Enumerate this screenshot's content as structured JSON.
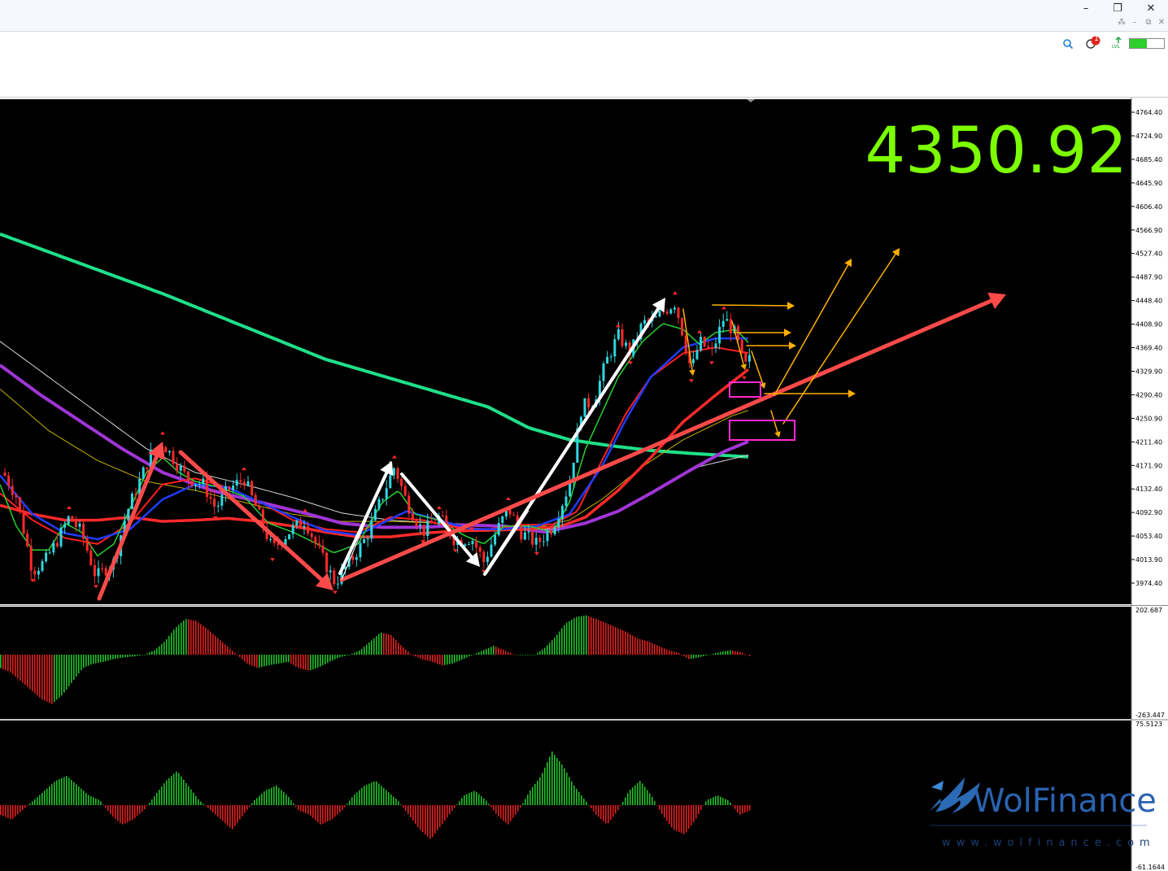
{
  "window": {
    "buttons": [
      {
        "name": "minimize",
        "glyph": "–"
      },
      {
        "name": "restore",
        "glyph": "❐"
      },
      {
        "name": "close",
        "glyph": "✕"
      }
    ],
    "sub_buttons": [
      "⁂",
      "–",
      "⧉",
      "✕"
    ]
  },
  "toolbar": {
    "search_icon": "search-icon",
    "notification_count": "1",
    "signal_label": "LVL",
    "battery_fill": 0.5
  },
  "chart_data": {
    "type": "candlestick",
    "current_price": "4350.92",
    "price_axis": {
      "ticks": [
        "4764.40",
        "4724.90",
        "4685.40",
        "4645.90",
        "4606.40",
        "4566.90",
        "4527.40",
        "4487.90",
        "4448.40",
        "4408.90",
        "4369.40",
        "4329.90",
        "4290.40",
        "4250.90",
        "4211.40",
        "4171.90",
        "4132.40",
        "4092.90",
        "4053.40",
        "4013.90",
        "3974.40"
      ],
      "min": 3950,
      "max": 4790
    },
    "macd_axis": {
      "ticks": [
        "202.687",
        "-263.447"
      ]
    },
    "osc_axis": {
      "ticks": [
        "75.5123",
        "-61.1644"
      ]
    },
    "colors": {
      "bull": "#2fd6e0",
      "bear": "#ff2a2a",
      "ma_fast_green": "#27d02f",
      "ma_blue": "#1f3cff",
      "ma_red_mid": "#ff2020",
      "ma_red_thick": "#ff2a2a",
      "ma_purple": "#a035d6",
      "ma_white": "#d8d8d8",
      "ma_yellow": "#c8b000",
      "ma_long": "#1fe08a",
      "price_text": "#7cff00",
      "hist_up": "#21c02a",
      "hist_down": "#e02020",
      "arrow_white": "#ffffff",
      "arrow_red": "#ff4a4a",
      "arrow_orange": "#ffb000",
      "box_pink": "#ff2ad0"
    },
    "price_path": [
      [
        0,
        4170
      ],
      [
        20,
        4120
      ],
      [
        40,
        3995
      ],
      [
        55,
        4010
      ],
      [
        70,
        4045
      ],
      [
        85,
        4085
      ],
      [
        100,
        4060
      ],
      [
        118,
        3985
      ],
      [
        140,
        4010
      ],
      [
        155,
        4090
      ],
      [
        170,
        4140
      ],
      [
        185,
        4190
      ],
      [
        200,
        4210
      ],
      [
        215,
        4180
      ],
      [
        230,
        4150
      ],
      [
        250,
        4140
      ],
      [
        265,
        4100
      ],
      [
        280,
        4130
      ],
      [
        300,
        4150
      ],
      [
        315,
        4100
      ],
      [
        335,
        4030
      ],
      [
        355,
        4060
      ],
      [
        375,
        4080
      ],
      [
        395,
        4020
      ],
      [
        412,
        3975
      ],
      [
        430,
        4010
      ],
      [
        450,
        4050
      ],
      [
        470,
        4120
      ],
      [
        485,
        4170
      ],
      [
        500,
        4110
      ],
      [
        520,
        4060
      ],
      [
        540,
        4085
      ],
      [
        560,
        4045
      ],
      [
        580,
        4050
      ],
      [
        595,
        4010
      ],
      [
        610,
        4060
      ],
      [
        625,
        4100
      ],
      [
        640,
        4060
      ],
      [
        660,
        4040
      ],
      [
        680,
        4070
      ],
      [
        700,
        4140
      ],
      [
        715,
        4270
      ],
      [
        730,
        4280
      ],
      [
        745,
        4345
      ],
      [
        760,
        4390
      ],
      [
        775,
        4360
      ],
      [
        790,
        4410
      ],
      [
        805,
        4415
      ],
      [
        815,
        4430
      ],
      [
        830,
        4445
      ],
      [
        840,
        4390
      ],
      [
        850,
        4330
      ],
      [
        860,
        4380
      ],
      [
        875,
        4360
      ],
      [
        890,
        4420
      ],
      [
        905,
        4390
      ],
      [
        915,
        4335
      ],
      [
        922,
        4350
      ]
    ],
    "moving_averages": {
      "ma_long": [
        [
          0,
          4560
        ],
        [
          100,
          4510
        ],
        [
          200,
          4460
        ],
        [
          300,
          4405
        ],
        [
          400,
          4350
        ],
        [
          500,
          4310
        ],
        [
          600,
          4270
        ],
        [
          650,
          4235
        ],
        [
          700,
          4215
        ],
        [
          750,
          4205
        ],
        [
          800,
          4197
        ],
        [
          850,
          4192
        ],
        [
          922,
          4186
        ]
      ],
      "ma_purple": [
        [
          0,
          4340
        ],
        [
          50,
          4290
        ],
        [
          100,
          4245
        ],
        [
          150,
          4200
        ],
        [
          200,
          4160
        ],
        [
          260,
          4130
        ],
        [
          320,
          4110
        ],
        [
          380,
          4090
        ],
        [
          420,
          4075
        ],
        [
          470,
          4068
        ],
        [
          520,
          4068
        ],
        [
          570,
          4072
        ],
        [
          620,
          4070
        ],
        [
          670,
          4060
        ],
        [
          720,
          4075
        ],
        [
          760,
          4095
        ],
        [
          800,
          4125
        ],
        [
          850,
          4165
        ],
        [
          890,
          4195
        ],
        [
          922,
          4213
        ]
      ],
      "ma_white": [
        [
          0,
          4380
        ],
        [
          60,
          4320
        ],
        [
          120,
          4260
        ],
        [
          180,
          4200
        ],
        [
          240,
          4160
        ],
        [
          300,
          4140
        ],
        [
          360,
          4118
        ],
        [
          420,
          4092
        ],
        [
          480,
          4080
        ],
        [
          540,
          4075
        ],
        [
          600,
          4072
        ],
        [
          660,
          4063
        ],
        [
          710,
          4070
        ],
        [
          760,
          4095
        ],
        [
          810,
          4135
        ],
        [
          860,
          4170
        ],
        [
          922,
          4190
        ]
      ],
      "ma_yellow": [
        [
          0,
          4300
        ],
        [
          60,
          4230
        ],
        [
          120,
          4180
        ],
        [
          180,
          4145
        ],
        [
          240,
          4130
        ],
        [
          300,
          4110
        ],
        [
          360,
          4090
        ],
        [
          420,
          4078
        ],
        [
          480,
          4078
        ],
        [
          540,
          4075
        ],
        [
          600,
          4070
        ],
        [
          660,
          4068
        ],
        [
          700,
          4080
        ],
        [
          740,
          4115
        ],
        [
          790,
          4170
        ],
        [
          840,
          4215
        ],
        [
          900,
          4255
        ],
        [
          922,
          4265
        ]
      ],
      "ma_red_thick": [
        [
          0,
          4105
        ],
        [
          40,
          4090
        ],
        [
          80,
          4080
        ],
        [
          120,
          4080
        ],
        [
          160,
          4085
        ],
        [
          200,
          4078
        ],
        [
          240,
          4080
        ],
        [
          280,
          4083
        ],
        [
          320,
          4078
        ],
        [
          360,
          4070
        ],
        [
          400,
          4060
        ],
        [
          440,
          4052
        ],
        [
          480,
          4052
        ],
        [
          520,
          4058
        ],
        [
          560,
          4062
        ],
        [
          600,
          4063
        ],
        [
          650,
          4065
        ],
        [
          690,
          4070
        ],
        [
          720,
          4085
        ],
        [
          760,
          4130
        ],
        [
          800,
          4185
        ],
        [
          840,
          4245
        ],
        [
          880,
          4290
        ],
        [
          922,
          4335
        ]
      ],
      "ma_red_mid": [
        [
          0,
          4125
        ],
        [
          40,
          4080
        ],
        [
          80,
          4050
        ],
        [
          120,
          4040
        ],
        [
          160,
          4075
        ],
        [
          200,
          4140
        ],
        [
          240,
          4150
        ],
        [
          280,
          4135
        ],
        [
          320,
          4110
        ],
        [
          360,
          4080
        ],
        [
          400,
          4065
        ],
        [
          440,
          4060
        ],
        [
          480,
          4085
        ],
        [
          520,
          4080
        ],
        [
          560,
          4068
        ],
        [
          600,
          4065
        ],
        [
          640,
          4072
        ],
        [
          680,
          4073
        ],
        [
          710,
          4095
        ],
        [
          740,
          4180
        ],
        [
          770,
          4260
        ],
        [
          800,
          4320
        ],
        [
          840,
          4360
        ],
        [
          880,
          4370
        ],
        [
          922,
          4360
        ]
      ],
      "ma_blue": [
        [
          0,
          4155
        ],
        [
          40,
          4090
        ],
        [
          80,
          4058
        ],
        [
          120,
          4048
        ],
        [
          160,
          4065
        ],
        [
          200,
          4115
        ],
        [
          240,
          4140
        ],
        [
          280,
          4135
        ],
        [
          320,
          4110
        ],
        [
          360,
          4085
        ],
        [
          400,
          4062
        ],
        [
          440,
          4055
        ],
        [
          470,
          4075
        ],
        [
          500,
          4095
        ],
        [
          540,
          4080
        ],
        [
          580,
          4065
        ],
        [
          620,
          4065
        ],
        [
          660,
          4070
        ],
        [
          700,
          4090
        ],
        [
          740,
          4170
        ],
        [
          770,
          4250
        ],
        [
          800,
          4320
        ],
        [
          840,
          4370
        ],
        [
          880,
          4385
        ],
        [
          922,
          4385
        ]
      ],
      "ma_fast_green": [
        [
          0,
          4140
        ],
        [
          20,
          4070
        ],
        [
          40,
          4030
        ],
        [
          60,
          4030
        ],
        [
          80,
          4075
        ],
        [
          100,
          4060
        ],
        [
          120,
          4020
        ],
        [
          140,
          4040
        ],
        [
          160,
          4100
        ],
        [
          180,
          4160
        ],
        [
          200,
          4185
        ],
        [
          220,
          4160
        ],
        [
          240,
          4145
        ],
        [
          270,
          4135
        ],
        [
          300,
          4120
        ],
        [
          330,
          4075
        ],
        [
          360,
          4060
        ],
        [
          390,
          4040
        ],
        [
          410,
          4025
        ],
        [
          440,
          4040
        ],
        [
          470,
          4110
        ],
        [
          490,
          4130
        ],
        [
          510,
          4090
        ],
        [
          540,
          4080
        ],
        [
          570,
          4055
        ],
        [
          595,
          4040
        ],
        [
          620,
          4070
        ],
        [
          650,
          4070
        ],
        [
          680,
          4060
        ],
        [
          700,
          4110
        ],
        [
          720,
          4200
        ],
        [
          740,
          4260
        ],
        [
          760,
          4320
        ],
        [
          790,
          4380
        ],
        [
          815,
          4410
        ],
        [
          840,
          4400
        ],
        [
          860,
          4375
        ],
        [
          880,
          4395
        ],
        [
          905,
          4400
        ],
        [
          922,
          4375
        ]
      ]
    },
    "macd_hist": [
      -15,
      -20,
      -30,
      -40,
      -50,
      -55,
      -45,
      -30,
      -15,
      -10,
      -8,
      -5,
      -3,
      -2,
      0,
      5,
      15,
      30,
      40,
      38,
      30,
      20,
      10,
      0,
      -10,
      -15,
      -12,
      -10,
      -8,
      -15,
      -18,
      -14,
      -8,
      -3,
      0,
      5,
      15,
      25,
      22,
      10,
      0,
      -5,
      -8,
      -12,
      -10,
      -5,
      0,
      5,
      10,
      5,
      0,
      0,
      0,
      8,
      20,
      35,
      42,
      44,
      40,
      35,
      30,
      25,
      18,
      15,
      10,
      5,
      2,
      -5,
      -3,
      0,
      3,
      5,
      3,
      -2
    ],
    "osc_hist": [
      -10,
      -15,
      -5,
      5,
      15,
      25,
      30,
      20,
      10,
      5,
      -10,
      -20,
      -15,
      -5,
      10,
      25,
      35,
      20,
      5,
      -5,
      -15,
      -25,
      -10,
      5,
      15,
      20,
      10,
      -5,
      -10,
      -20,
      -15,
      -5,
      10,
      20,
      25,
      15,
      5,
      -10,
      -25,
      -35,
      -20,
      -5,
      10,
      15,
      5,
      -10,
      -20,
      -5,
      15,
      30,
      55,
      40,
      20,
      5,
      -10,
      -20,
      -5,
      15,
      25,
      10,
      -10,
      -25,
      -30,
      -15,
      5,
      10,
      5,
      -10,
      -5
    ],
    "annotations": {
      "white_arrows": [
        [
          [
            418,
            705
          ],
          [
            482,
            567
          ]
        ],
        [
          [
            494,
            583
          ],
          [
            590,
            697
          ]
        ],
        [
          [
            596,
            706
          ],
          [
            818,
            366
          ]
        ]
      ],
      "red_arrows": [
        [
          [
            122,
            736
          ],
          [
            200,
            543
          ]
        ],
        [
          [
            222,
            556
          ],
          [
            410,
            726
          ]
        ],
        [
          [
            420,
            713
          ],
          [
            1237,
            362
          ]
        ]
      ],
      "orange_up": [
        [
          [
            952,
            486
          ],
          [
            1047,
            318
          ]
        ],
        [
          [
            963,
            521
          ],
          [
            1106,
            305
          ]
        ]
      ],
      "orange_right": [
        [
          [
            876,
            375
          ],
          [
            977,
            376
          ]
        ],
        [
          [
            905,
            409
          ],
          [
            973,
            409
          ]
        ],
        [
          [
            918,
            425
          ],
          [
            979,
            425
          ]
        ],
        [
          [
            940,
            484
          ],
          [
            1052,
            484
          ]
        ]
      ],
      "pink_boxes": [
        [
          897,
          470,
          38,
          18
        ],
        [
          897,
          517,
          80,
          24
        ]
      ]
    }
  },
  "logo": {
    "brand": "WolFinance",
    "site": "www.wolfinance.com"
  }
}
